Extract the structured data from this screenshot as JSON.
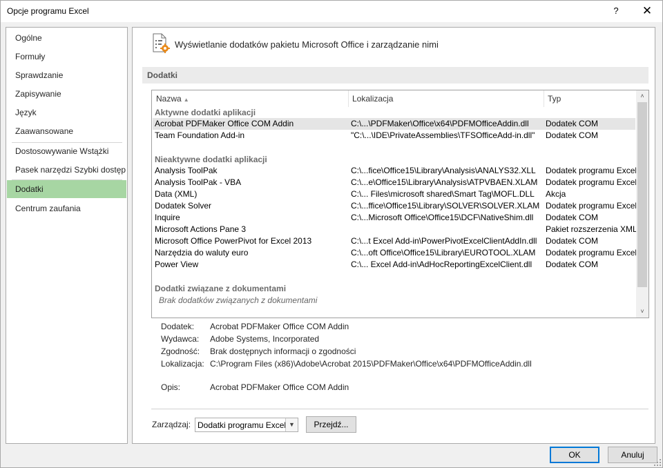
{
  "window": {
    "title": "Opcje programu Excel",
    "help_label": "?",
    "close_label": "✕"
  },
  "sidebar": {
    "items": [
      {
        "label": "Ogólne"
      },
      {
        "label": "Formuły"
      },
      {
        "label": "Sprawdzanie"
      },
      {
        "label": "Zapisywanie"
      },
      {
        "label": "Język"
      },
      {
        "label": "Zaawansowane"
      },
      {
        "label": "Dostosowywanie Wstążki"
      },
      {
        "label": "Pasek narzędzi Szybki dostęp"
      },
      {
        "label": "Dodatki"
      },
      {
        "label": "Centrum zaufania"
      }
    ],
    "active_index": 8,
    "active_color": "#a7d6a3"
  },
  "content": {
    "header": "Wyświetlanie dodatków pakietu Microsoft Office i zarządzanie nimi",
    "header_icon": "addin-settings-icon",
    "section_title": "Dodatki"
  },
  "table": {
    "columns": {
      "name": "Nazwa",
      "location": "Lokalizacja",
      "type": "Typ"
    },
    "sort_indicator": "▲",
    "active_group": "Aktywne dodatki aplikacji",
    "active_rows": [
      {
        "name": "Acrobat PDFMaker Office COM Addin",
        "location": "C:\\...\\PDFMaker\\Office\\x64\\PDFMOfficeAddin.dll",
        "type": "Dodatek COM"
      },
      {
        "name": "Team Foundation Add-in",
        "location": "\"C:\\...\\IDE\\PrivateAssemblies\\TFSOfficeAdd-in.dll\"",
        "type": "Dodatek COM"
      }
    ],
    "inactive_group": "Nieaktywne dodatki aplikacji",
    "inactive_rows": [
      {
        "name": "Analysis ToolPak",
        "location": "C:\\...fice\\Office15\\Library\\Analysis\\ANALYS32.XLL",
        "type": "Dodatek programu Excel"
      },
      {
        "name": "Analysis ToolPak - VBA",
        "location": "C:\\...e\\Office15\\Library\\Analysis\\ATPVBAEN.XLAM",
        "type": "Dodatek programu Excel"
      },
      {
        "name": "Data (XML)",
        "location": "C:\\... Files\\microsoft shared\\Smart Tag\\MOFL.DLL",
        "type": "Akcja"
      },
      {
        "name": "Dodatek Solver",
        "location": "C:\\...ffice\\Office15\\Library\\SOLVER\\SOLVER.XLAM",
        "type": "Dodatek programu Excel"
      },
      {
        "name": "Inquire",
        "location": "C:\\...Microsoft Office\\Office15\\DCF\\NativeShim.dll",
        "type": "Dodatek COM"
      },
      {
        "name": "Microsoft Actions Pane 3",
        "location": "",
        "type": "Pakiet rozszerzenia XML"
      },
      {
        "name": "Microsoft Office PowerPivot for Excel 2013",
        "location": "C:\\...t Excel Add-in\\PowerPivotExcelClientAddIn.dll",
        "type": "Dodatek COM"
      },
      {
        "name": "Narzędzia do waluty euro",
        "location": "C:\\...oft Office\\Office15\\Library\\EUROTOOL.XLAM",
        "type": "Dodatek programu Excel"
      },
      {
        "name": "Power View",
        "location": "C:\\... Excel Add-in\\AdHocReportingExcelClient.dll",
        "type": "Dodatek COM"
      }
    ],
    "document_group": "Dodatki związane z dokumentami",
    "document_empty": "Brak dodatków związanych z dokumentami",
    "scroll_up": "˄",
    "scroll_down": "˅"
  },
  "details": {
    "addin_label": "Dodatek:",
    "addin_value": "Acrobat PDFMaker Office COM Addin",
    "publisher_label": "Wydawca:",
    "publisher_value": "Adobe Systems, Incorporated",
    "compat_label": "Zgodność:",
    "compat_value": "Brak dostępnych informacji o zgodności",
    "location_label": "Lokalizacja:",
    "location_value": "C:\\Program Files (x86)\\Adobe\\Acrobat 2015\\PDFMaker\\Office\\x64\\PDFMOfficeAddin.dll",
    "desc_label": "Opis:",
    "desc_value": "Acrobat PDFMaker Office COM Addin"
  },
  "manage": {
    "label": "Zarządzaj:",
    "selected": "Dodatki programu Excel",
    "go_label": "Przejdź..."
  },
  "footer": {
    "ok_label": "OK",
    "cancel_label": "Anuluj",
    "focus_color": "#0078d7"
  }
}
